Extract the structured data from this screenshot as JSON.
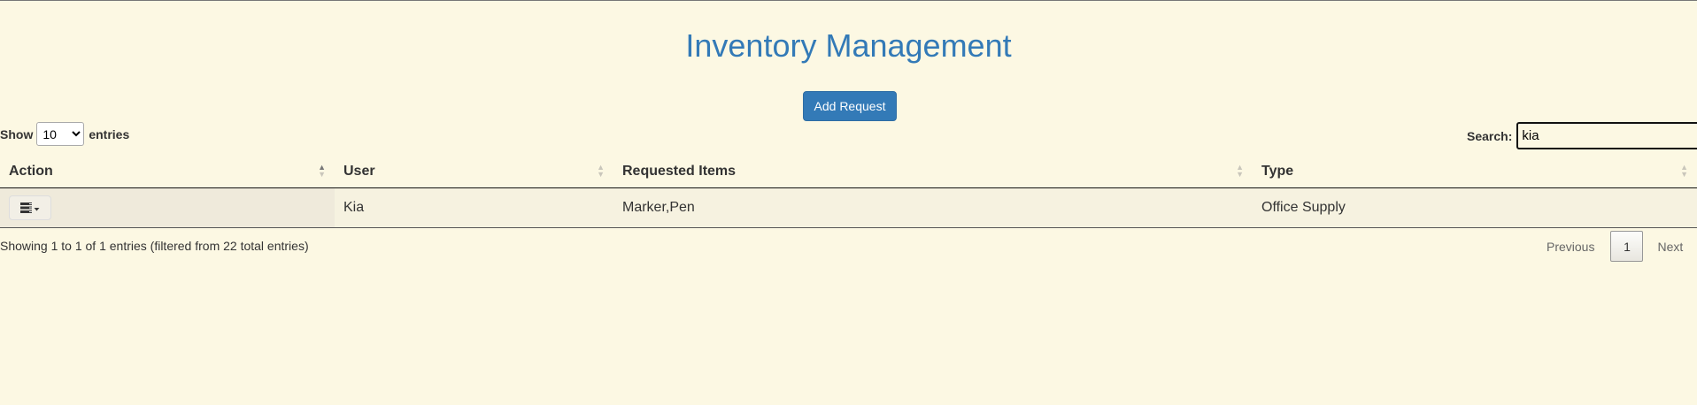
{
  "page": {
    "title": "Inventory Management",
    "add_button": "Add Request"
  },
  "length": {
    "show_label": "Show",
    "entries_label": "entries",
    "options": [
      "10"
    ],
    "selected": "10"
  },
  "search": {
    "label": "Search:",
    "value": "kia"
  },
  "table": {
    "columns": [
      "Action",
      "User",
      "Requested Items",
      "Type"
    ],
    "rows": [
      {
        "user": "Kia",
        "items": "Marker,Pen",
        "type": "Office Supply"
      }
    ]
  },
  "footer": {
    "info": "Showing 1 to 1 of 1 entries (filtered from 22 total entries)",
    "previous": "Previous",
    "current_page": "1",
    "next": "Next"
  },
  "icons": {
    "action": "list-dropdown-icon",
    "sort": "sort-arrows-icon"
  },
  "colors": {
    "background": "#fcf8e3",
    "accent": "#337ab7"
  }
}
